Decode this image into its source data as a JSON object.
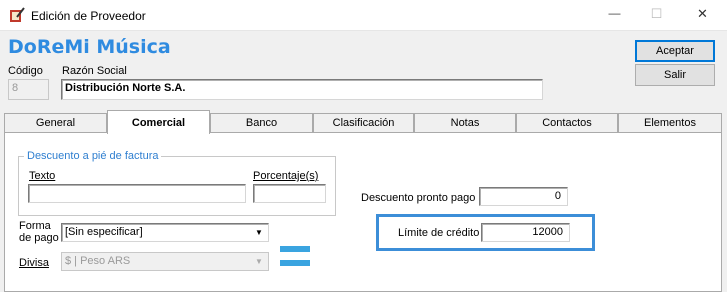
{
  "window": {
    "title": "Edición de Proveedor",
    "app_icon": "book-pencil-icon",
    "controls": {
      "minimize": "—",
      "maximize": "☐",
      "close": "✕"
    }
  },
  "brand": "DoReMi Música",
  "header": {
    "code_label": "Código",
    "code_value": "8",
    "name_label": "Razón Social",
    "name_value": "Distribución Norte S.A."
  },
  "buttons": {
    "accept": "Aceptar",
    "exit": "Salir"
  },
  "tabs": [
    {
      "label": "General",
      "active": false
    },
    {
      "label": "Comercial",
      "active": true
    },
    {
      "label": "Banco",
      "active": false
    },
    {
      "label": "Clasificación",
      "active": false
    },
    {
      "label": "Notas",
      "active": false
    },
    {
      "label": "Contactos",
      "active": false
    },
    {
      "label": "Elementos",
      "active": false
    }
  ],
  "comercial": {
    "discount_group": {
      "title": "Descuento a pié de factura",
      "text_label": "Texto",
      "text_value": "",
      "percent_label": "Porcentaje(s)",
      "percent_value": ""
    },
    "payment": {
      "label_line1": "Forma",
      "label_line2": "de pago",
      "value": "[Sin especificar]"
    },
    "currency": {
      "label": "Divisa",
      "value": "$ | Peso ARS"
    },
    "prompt_discount": {
      "label": "Descuento pronto pago",
      "value": "0"
    },
    "credit_limit": {
      "label": "Límite de crédito",
      "value": "12000"
    }
  },
  "colors": {
    "brand": "#2f8be0",
    "highlight": "#3c8ed8",
    "accent_equals": "#3aa4e0"
  }
}
